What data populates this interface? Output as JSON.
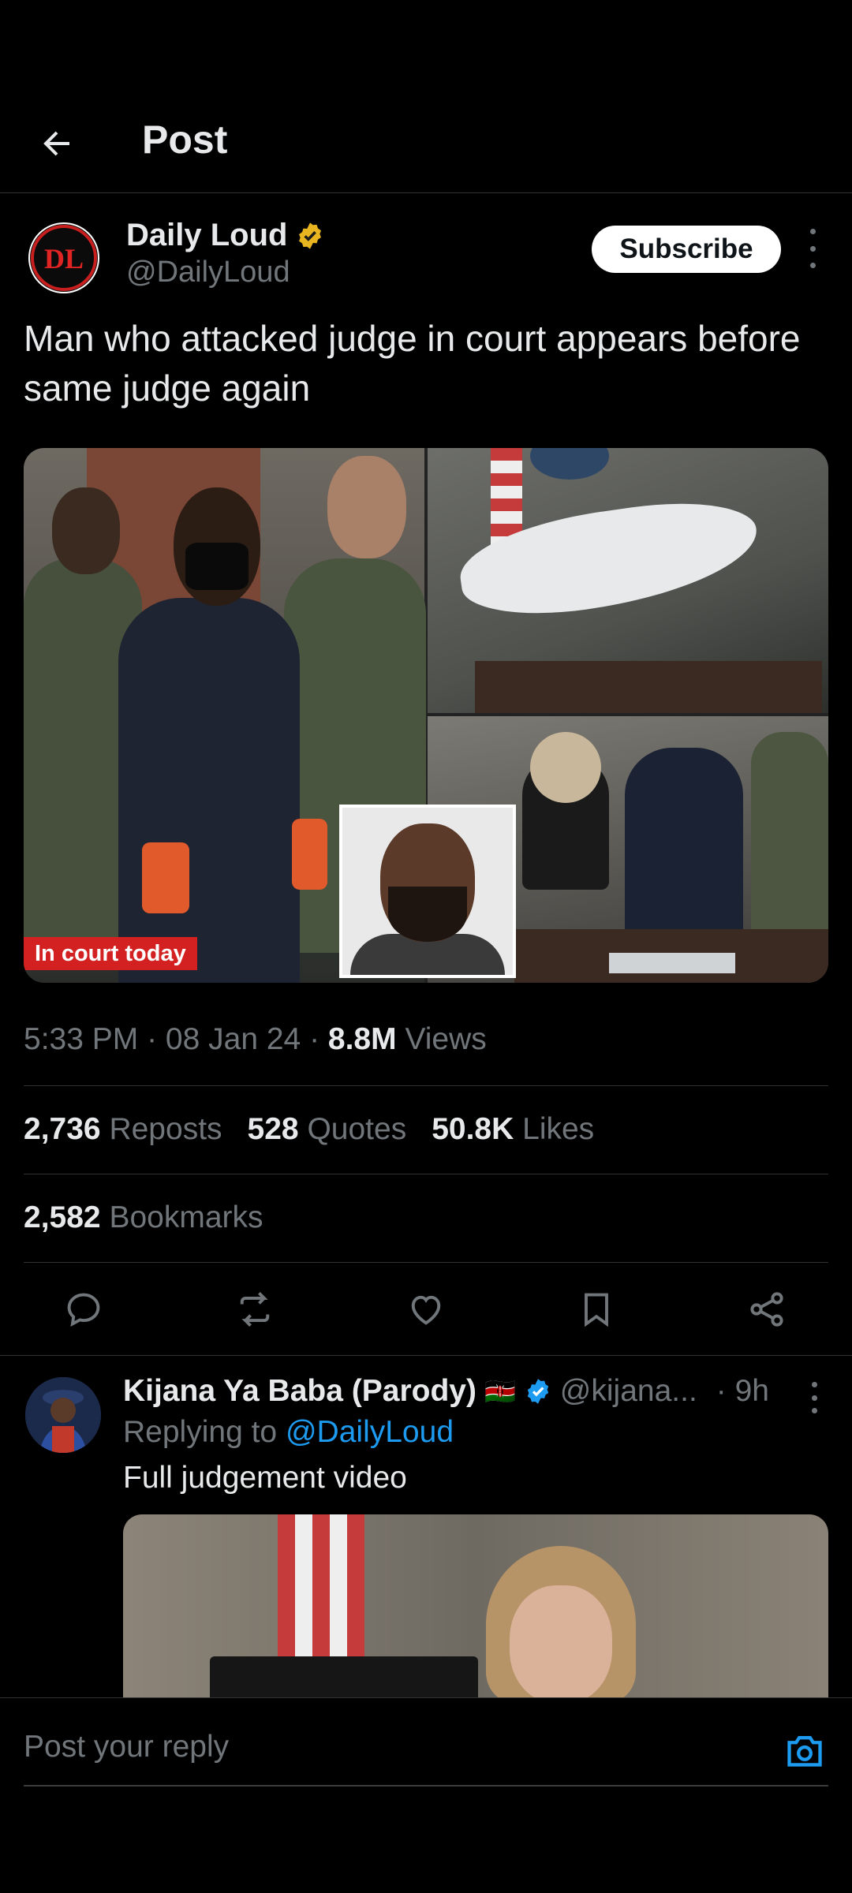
{
  "header": {
    "title": "Post",
    "back_icon": "arrow-left-icon"
  },
  "post": {
    "author_name": "Daily Loud",
    "author_handle": "@DailyLoud",
    "verified_badge_color": "#e8b41f",
    "subscribe_label": "Subscribe",
    "text": "Man who attacked judge in court appears before same judge again",
    "media_caption": "In court today",
    "time": "5:33 PM",
    "date": "08 Jan 24",
    "views_count": "8.8M",
    "views_label": "Views",
    "reposts_count": "2,736",
    "reposts_label": "Reposts",
    "quotes_count": "528",
    "quotes_label": "Quotes",
    "likes_count": "50.8K",
    "likes_label": "Likes",
    "bookmarks_count": "2,582",
    "bookmarks_label": "Bookmarks"
  },
  "actions": [
    "reply-icon",
    "repost-icon",
    "like-icon",
    "bookmark-icon",
    "share-icon"
  ],
  "reply": {
    "name": "Kijana Ya Baba (Parody)",
    "flag": "🇰🇪",
    "handle": "@kijana...",
    "time": "· 9h",
    "replying_prefix": "Replying to",
    "replying_to": "@DailyLoud",
    "text": "Full judgement video"
  },
  "composer": {
    "placeholder": "Post your reply",
    "camera_icon": "camera-icon",
    "accent": "#1d9bf0"
  }
}
